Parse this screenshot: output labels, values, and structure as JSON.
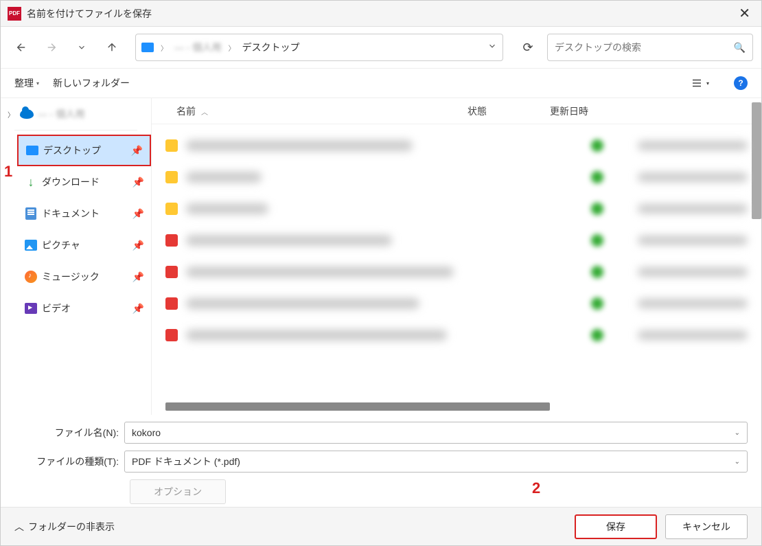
{
  "titlebar": {
    "title": "名前を付けてファイルを保存"
  },
  "breadcrumb": {
    "user": "— - 個人用",
    "location": "デスクトップ"
  },
  "search": {
    "placeholder": "デスクトップの検索"
  },
  "toolbar": {
    "organize": "整理",
    "new_folder": "新しいフォルダー"
  },
  "columns": {
    "name": "名前",
    "state": "状態",
    "date": "更新日時"
  },
  "sidebar": {
    "top": "— - 個人用",
    "items": [
      {
        "label": "デスクトップ"
      },
      {
        "label": "ダウンロード"
      },
      {
        "label": "ドキュメント"
      },
      {
        "label": "ピクチャ"
      },
      {
        "label": "ミュージック"
      },
      {
        "label": "ビデオ"
      }
    ]
  },
  "form": {
    "filename_label": "ファイル名(N):",
    "filename_value": "kokoro",
    "filetype_label": "ファイルの種類(T):",
    "filetype_value": "PDF ドキュメント (*.pdf)",
    "options": "オプション"
  },
  "footer": {
    "hide_folders": "フォルダーの非表示",
    "save": "保存",
    "cancel": "キャンセル"
  },
  "annotations": {
    "one": "1",
    "two": "2"
  }
}
